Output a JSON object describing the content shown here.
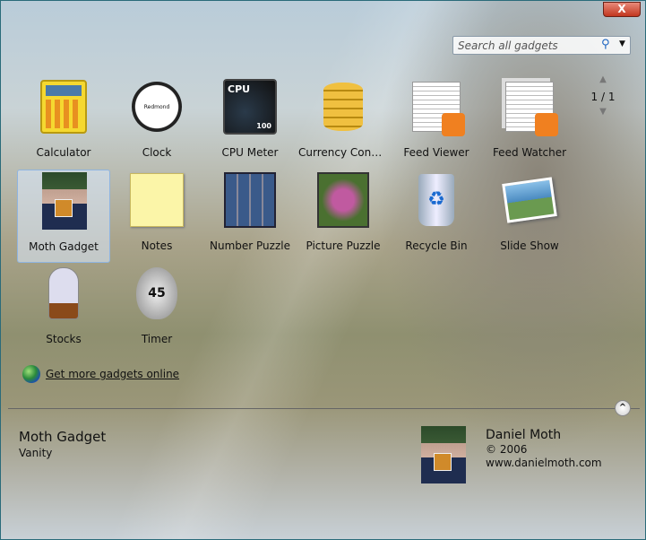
{
  "window": {
    "close_label": "X"
  },
  "search": {
    "placeholder": "Search all gadgets"
  },
  "pager": {
    "text": "1 / 1",
    "up": "▲",
    "down": "▼"
  },
  "gadgets": [
    {
      "label": "Calculator",
      "icon": "calculator-icon"
    },
    {
      "label": "Clock",
      "icon": "clock-icon"
    },
    {
      "label": "CPU Meter",
      "icon": "cpu-meter-icon"
    },
    {
      "label": "Currency Convers…",
      "icon": "coins-icon"
    },
    {
      "label": "Feed Viewer",
      "icon": "feed-viewer-icon"
    },
    {
      "label": "Feed Watcher",
      "icon": "feed-watcher-icon"
    },
    {
      "label": "Moth Gadget",
      "icon": "moth-gadget-icon",
      "selected": true
    },
    {
      "label": "Notes",
      "icon": "notes-icon"
    },
    {
      "label": "Number Puzzle",
      "icon": "number-puzzle-icon"
    },
    {
      "label": "Picture Puzzle",
      "icon": "picture-puzzle-icon"
    },
    {
      "label": "Recycle Bin",
      "icon": "recycle-bin-icon"
    },
    {
      "label": "Slide Show",
      "icon": "slide-show-icon"
    },
    {
      "label": "Stocks",
      "icon": "stocks-icon"
    },
    {
      "label": "Timer",
      "icon": "timer-icon"
    }
  ],
  "icon_text": {
    "cpu": "CPU",
    "cpu_value": "100",
    "timer": "45",
    "clock": "Redmond"
  },
  "more_link": "Get more gadgets online",
  "details": {
    "name": "Moth Gadget",
    "category": "Vanity",
    "author": "Daniel Moth",
    "copyright": "© 2006",
    "url": "www.danielmoth.com"
  },
  "colors": {
    "selection": "#8fb4e0",
    "close": "#c2361f"
  }
}
